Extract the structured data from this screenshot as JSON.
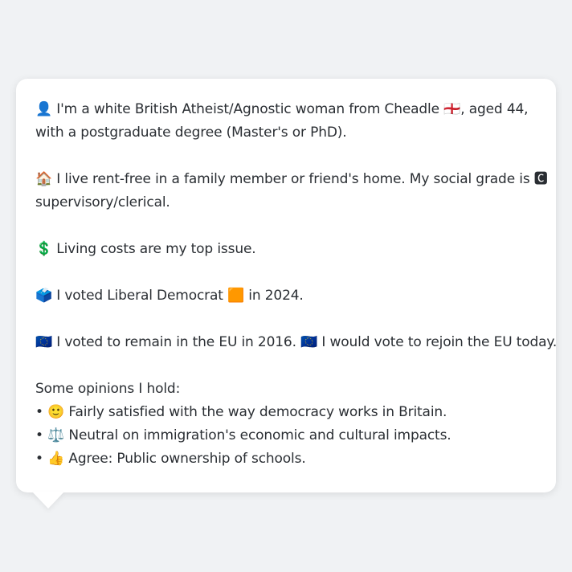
{
  "profile": {
    "identity": {
      "line1": "👤 I'm a white British Atheist/Agnostic woman from Cheadle 🏴󠁧󠁢󠁥󠁮󠁧󠁿, aged 44,",
      "line2": "with a postgraduate degree (Master's or PhD)."
    },
    "housing": {
      "line1": "🏠 I live rent-free in a family member or friend's home. My social grade is 🅲",
      "line2": "supervisory/clerical."
    },
    "top_issue": "💲 Living costs are my top issue.",
    "vote_2024": "🗳️ I voted Liberal Democrat 🟧 in 2024.",
    "eu": "🇪🇺 I voted to remain in the EU in 2016. 🇪🇺 I would vote to rejoin the EU today.",
    "opinions_heading": "Some opinions I hold:",
    "opinions": [
      "• 🙂 Fairly satisfied with the way democracy works in Britain.",
      "• ⚖️ Neutral on immigration's economic and cultural impacts.",
      "• 👍 Agree: Public ownership of schools."
    ]
  }
}
